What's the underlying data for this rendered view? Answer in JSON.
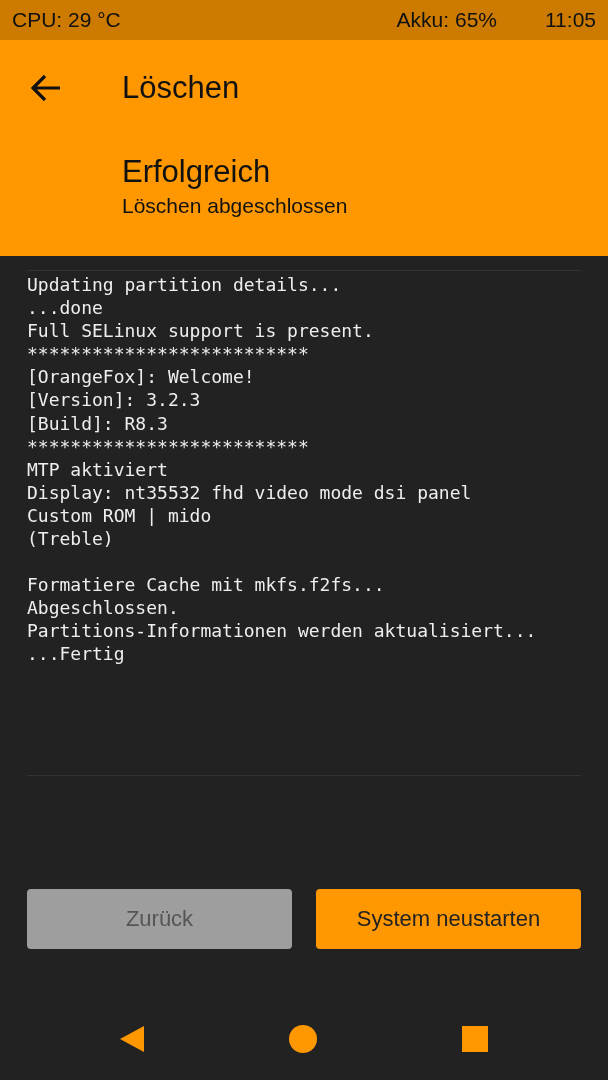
{
  "status_bar": {
    "cpu": "CPU: 29 °C",
    "battery": "Akku: 65%",
    "time": "11:05"
  },
  "header": {
    "title": "Löschen",
    "status": "Erfolgreich",
    "subtitle": "Löschen abgeschlossen"
  },
  "log": [
    [
      "Updating partition details...",
      "...done",
      "Full SELinux support is present.",
      "**************************",
      "[OrangeFox]: Welcome!",
      "[Version]: 3.2.3",
      "[Build]: R8.3",
      "**************************",
      "MTP aktiviert",
      "Display: nt35532 fhd video mode dsi panel",
      "Custom ROM | mido",
      "(Treble)"
    ],
    [
      "Formatiere Cache mit mkfs.f2fs...",
      "Abgeschlossen.",
      "Partitions-Informationen werden aktualisiert...",
      "...Fertig"
    ]
  ],
  "buttons": [
    {
      "label": "Zurück",
      "disabled": true
    },
    {
      "label": "System neustarten",
      "disabled": false
    }
  ]
}
